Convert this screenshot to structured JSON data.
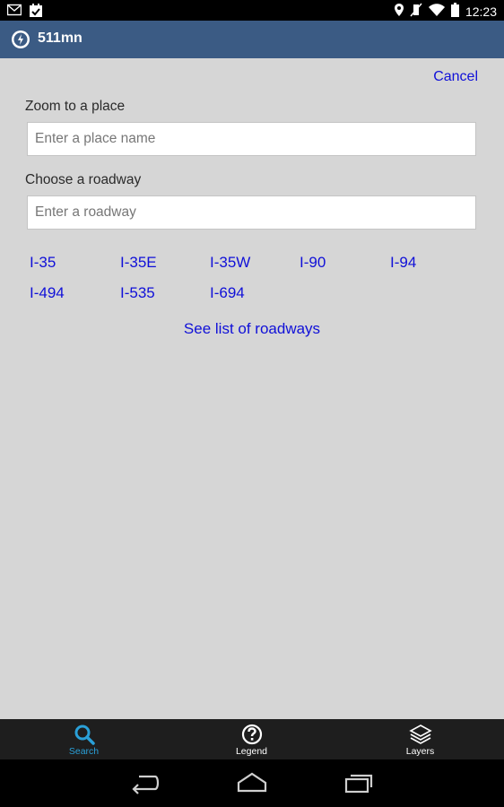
{
  "status_bar": {
    "time": "12:23"
  },
  "app_bar": {
    "title": "511mn"
  },
  "search": {
    "cancel_label": "Cancel",
    "place_label": "Zoom to a place",
    "place_placeholder": "Enter a place name",
    "place_value": "",
    "roadway_label": "Choose a roadway",
    "roadway_placeholder": "Enter a roadway",
    "roadway_value": ""
  },
  "roadways": [
    "I-35",
    "I-35E",
    "I-35W",
    "I-90",
    "I-94",
    "I-494",
    "I-535",
    "I-694"
  ],
  "see_list_label": "See list of roadways",
  "tabs": [
    {
      "label": "Search",
      "icon": "search-icon",
      "active": true
    },
    {
      "label": "Legend",
      "icon": "question-icon",
      "active": false
    },
    {
      "label": "Layers",
      "icon": "layers-icon",
      "active": false
    }
  ],
  "colors": {
    "app_bar": "#3b5b84",
    "link": "#1010d8",
    "active_tab": "#2aa0d8",
    "background": "#d6d6d6"
  }
}
